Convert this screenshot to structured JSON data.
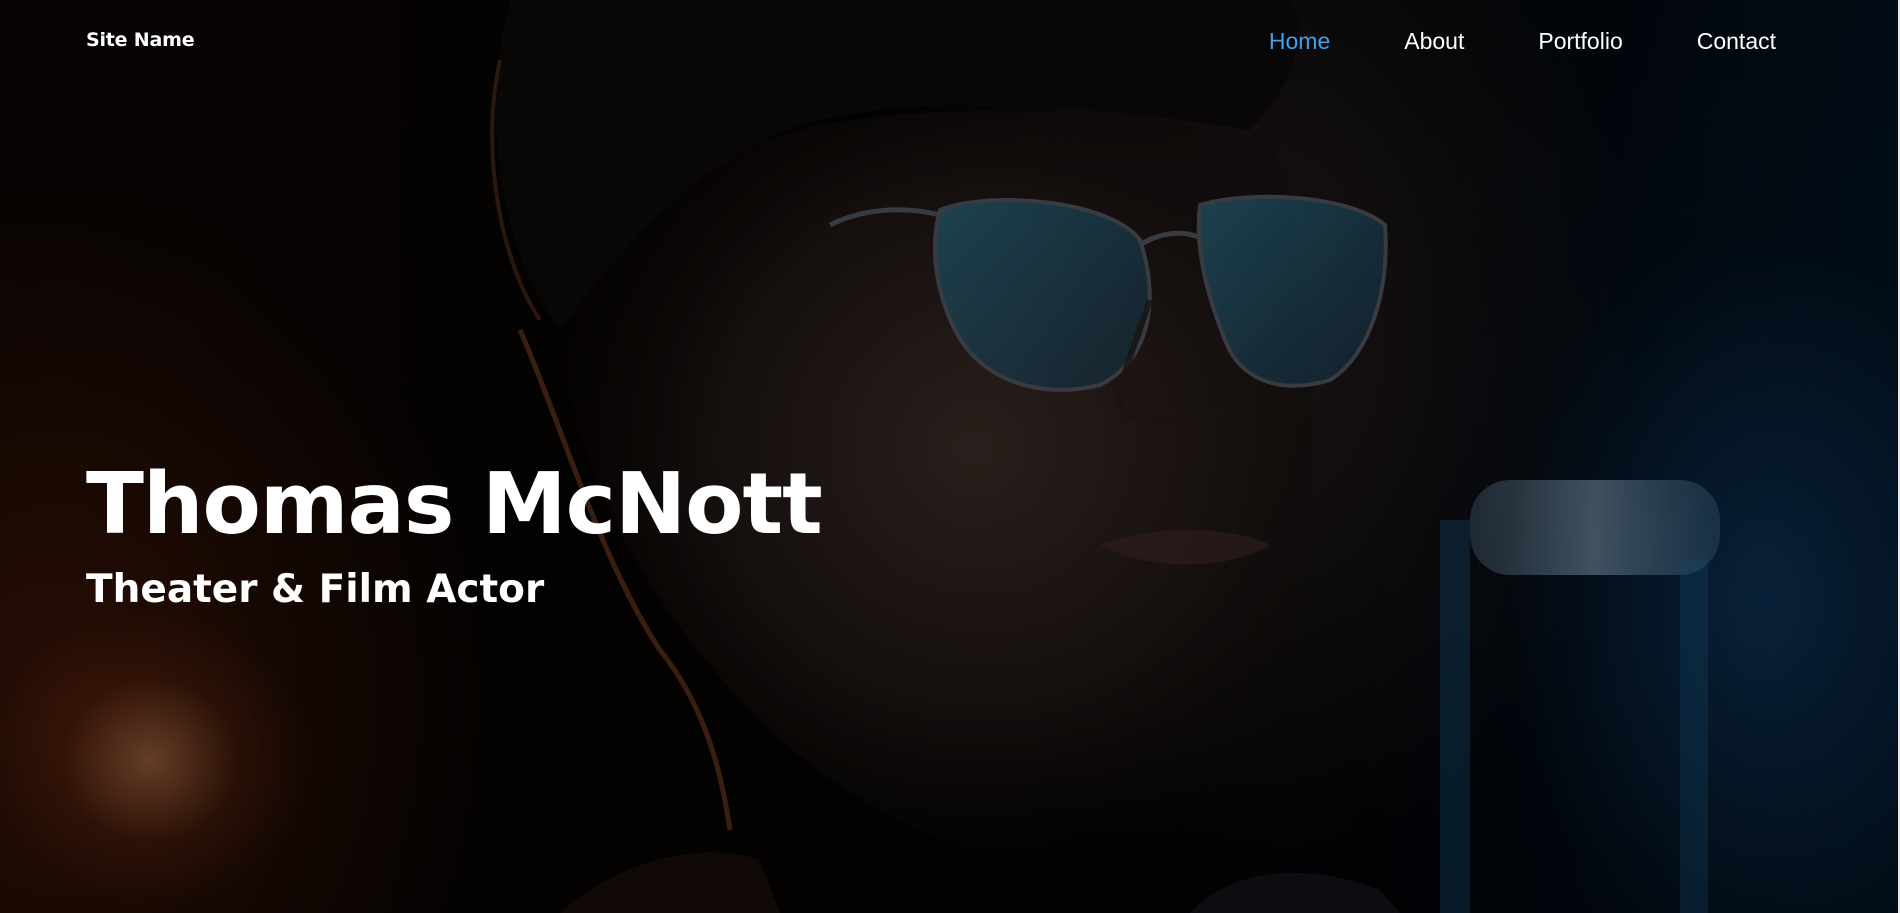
{
  "header": {
    "site_name": "Site Name",
    "nav": [
      {
        "label": "Home",
        "active": true
      },
      {
        "label": "About",
        "active": false
      },
      {
        "label": "Portfolio",
        "active": false
      },
      {
        "label": "Contact",
        "active": false
      }
    ]
  },
  "hero": {
    "title": "Thomas McNott",
    "subtitle": "Theater & Film Actor",
    "background_image": "portrait-photo"
  },
  "colors": {
    "accent": "#3fa2ee",
    "text": "#ffffff",
    "background": "#050302"
  }
}
